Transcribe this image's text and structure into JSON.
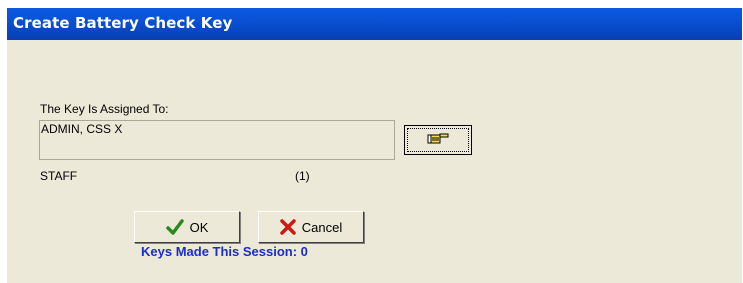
{
  "window": {
    "title": "Create Battery Check Key"
  },
  "assignment": {
    "label": "The Key Is Assigned To:",
    "assignee_name": "ADMIN, CSS X",
    "assignee_role": "STAFF",
    "assignee_count": "(1)",
    "lookup_icon": "hand-pointer-icon"
  },
  "buttons": {
    "ok_label": "OK",
    "ok_icon": "checkmark-icon",
    "cancel_label": "Cancel",
    "cancel_icon": "x-icon"
  },
  "status": {
    "session_text": "Keys Made This Session: 0"
  },
  "colors": {
    "title_bar": "#0a52d6",
    "dialog_bg": "#ece9d8",
    "status_text": "#1a2ec8",
    "ok_check": "#2a8a1a",
    "cancel_x": "#cc1a10"
  }
}
